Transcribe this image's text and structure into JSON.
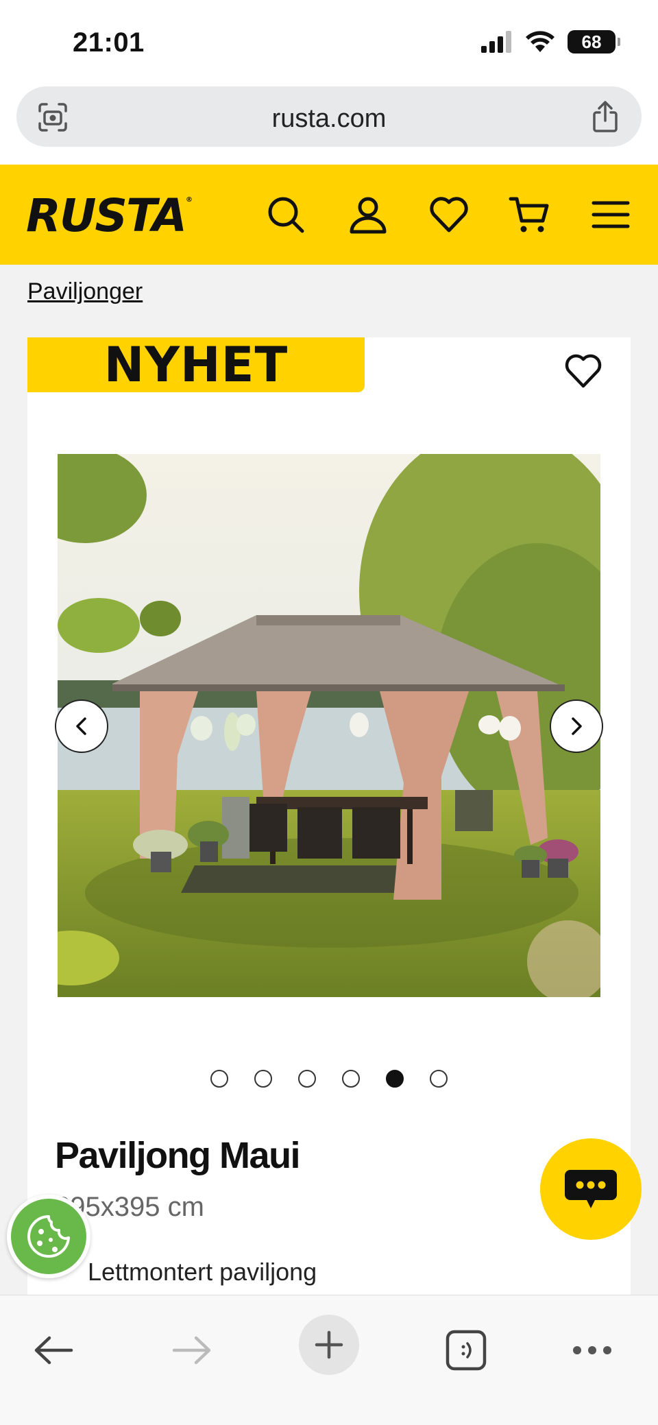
{
  "status": {
    "time": "21:01",
    "battery": "68"
  },
  "browser": {
    "url": "rusta.com"
  },
  "header": {
    "logo": "RUSTA"
  },
  "breadcrumb": "Paviljonger",
  "product": {
    "badge": "NYHET",
    "title": "Paviljong Maui",
    "size": "295x395 cm",
    "features": [
      "Lettmontert paviljong"
    ],
    "image_count": 6,
    "active_image_index": 4
  },
  "icons": {
    "search": "search-icon",
    "account": "user-icon",
    "wishlist": "heart-icon",
    "cart": "cart-icon",
    "menu": "hamburger-icon",
    "chat": "chat-icon",
    "cookie": "cookie-icon"
  },
  "colors": {
    "brand_yellow": "#ffd200",
    "cookie_green": "#68b94a"
  }
}
